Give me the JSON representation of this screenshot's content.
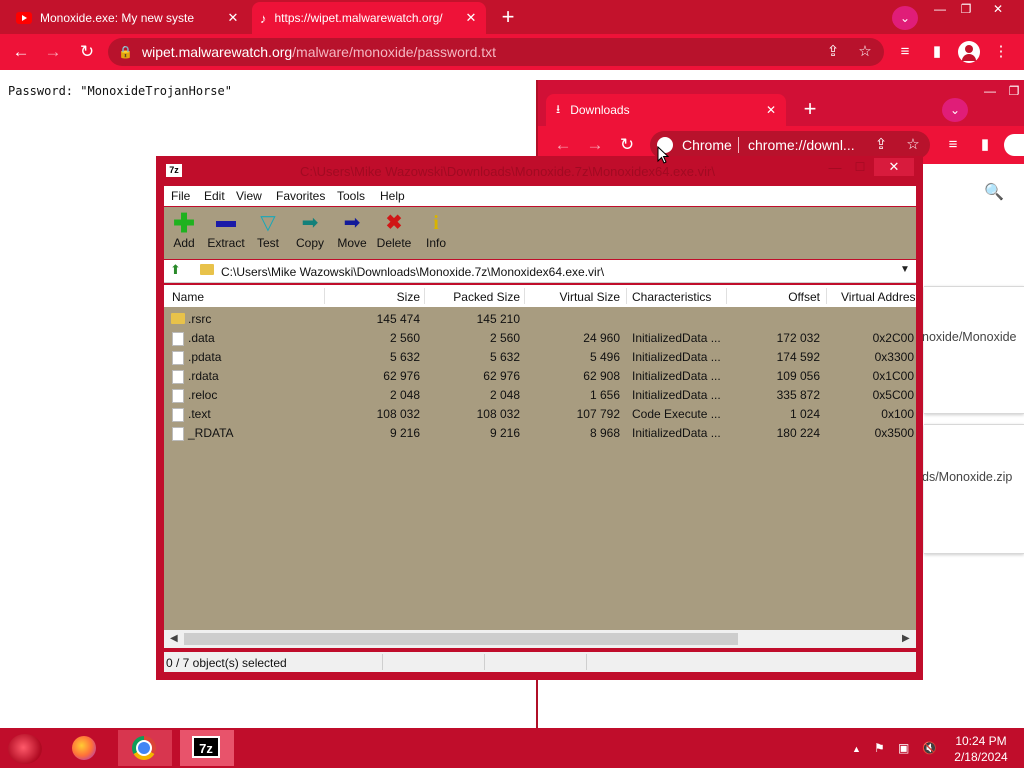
{
  "browser": {
    "tabs": [
      {
        "title": "Monoxide.exe: My new syste",
        "icon": "youtube-icon"
      },
      {
        "title": "https://wipet.malwarewatch.org/",
        "icon": "page-icon"
      }
    ],
    "url_host": "wipet.malwarewatch.org",
    "url_path": "/malware/monoxide/password.txt",
    "page_text": "Password: \"MonoxideTrojanHorse\""
  },
  "downloads_window": {
    "tab_title": "Downloads",
    "chip_label": "Chrome",
    "url": "chrome://downl...",
    "path1": "noxide/Monoxide",
    "path2": "ds/Monoxide.zip"
  },
  "sevenzip": {
    "title": "C:\\Users\\Mike Wazowski\\Downloads\\Monoxide.7z\\Monoxidex64.exe.vir\\",
    "logo": "7z",
    "menu": [
      "File",
      "Edit",
      "View",
      "Favorites",
      "Tools",
      "Help"
    ],
    "toolbar": [
      {
        "label": "Add",
        "icon": "plus-icon",
        "color": "#1fb21f"
      },
      {
        "label": "Extract",
        "icon": "minus-icon",
        "color": "#1a1aa8"
      },
      {
        "label": "Test",
        "icon": "check-icon",
        "color": "#19a7b8"
      },
      {
        "label": "Copy",
        "icon": "arrow-right-icon",
        "color": "#12807a"
      },
      {
        "label": "Move",
        "icon": "arrow-right-icon",
        "color": "#121a9a"
      },
      {
        "label": "Delete",
        "icon": "x-icon",
        "color": "#d01616"
      },
      {
        "label": "Info",
        "icon": "info-icon",
        "color": "#d8b400"
      }
    ],
    "path": "C:\\Users\\Mike Wazowski\\Downloads\\Monoxide.7z\\Monoxidex64.exe.vir\\",
    "columns": [
      "Name",
      "Size",
      "Packed Size",
      "Virtual Size",
      "Characteristics",
      "Offset",
      "Virtual Addres"
    ],
    "rows": [
      {
        "name": ".rsrc",
        "size": "145 474",
        "packed": "145 210",
        "vsize": "",
        "chars": "",
        "offset": "",
        "vaddr": "",
        "folder": true
      },
      {
        "name": ".data",
        "size": "2 560",
        "packed": "2 560",
        "vsize": "24 960",
        "chars": "InitializedData ...",
        "offset": "172 032",
        "vaddr": "0x2C00"
      },
      {
        "name": ".pdata",
        "size": "5 632",
        "packed": "5 632",
        "vsize": "5 496",
        "chars": "InitializedData ...",
        "offset": "174 592",
        "vaddr": "0x3300"
      },
      {
        "name": ".rdata",
        "size": "62 976",
        "packed": "62 976",
        "vsize": "62 908",
        "chars": "InitializedData ...",
        "offset": "109 056",
        "vaddr": "0x1C00"
      },
      {
        "name": ".reloc",
        "size": "2 048",
        "packed": "2 048",
        "vsize": "1 656",
        "chars": "InitializedData ...",
        "offset": "335 872",
        "vaddr": "0x5C00"
      },
      {
        "name": ".text",
        "size": "108 032",
        "packed": "108 032",
        "vsize": "107 792",
        "chars": "Code Execute ...",
        "offset": "1 024",
        "vaddr": "0x100"
      },
      {
        "name": "_RDATA",
        "size": "9 216",
        "packed": "9 216",
        "vsize": "8 968",
        "chars": "InitializedData ...",
        "offset": "180 224",
        "vaddr": "0x3500"
      }
    ],
    "status": "0 / 7 object(s) selected"
  },
  "taskbar": {
    "time": "10:24 PM",
    "date": "2/18/2024",
    "apps": [
      "firefox-icon",
      "chrome-icon",
      "7zip-icon"
    ]
  },
  "colors": {
    "accent": "#c3122c",
    "tab_active": "#ee1238",
    "panel": "#a89c80"
  }
}
